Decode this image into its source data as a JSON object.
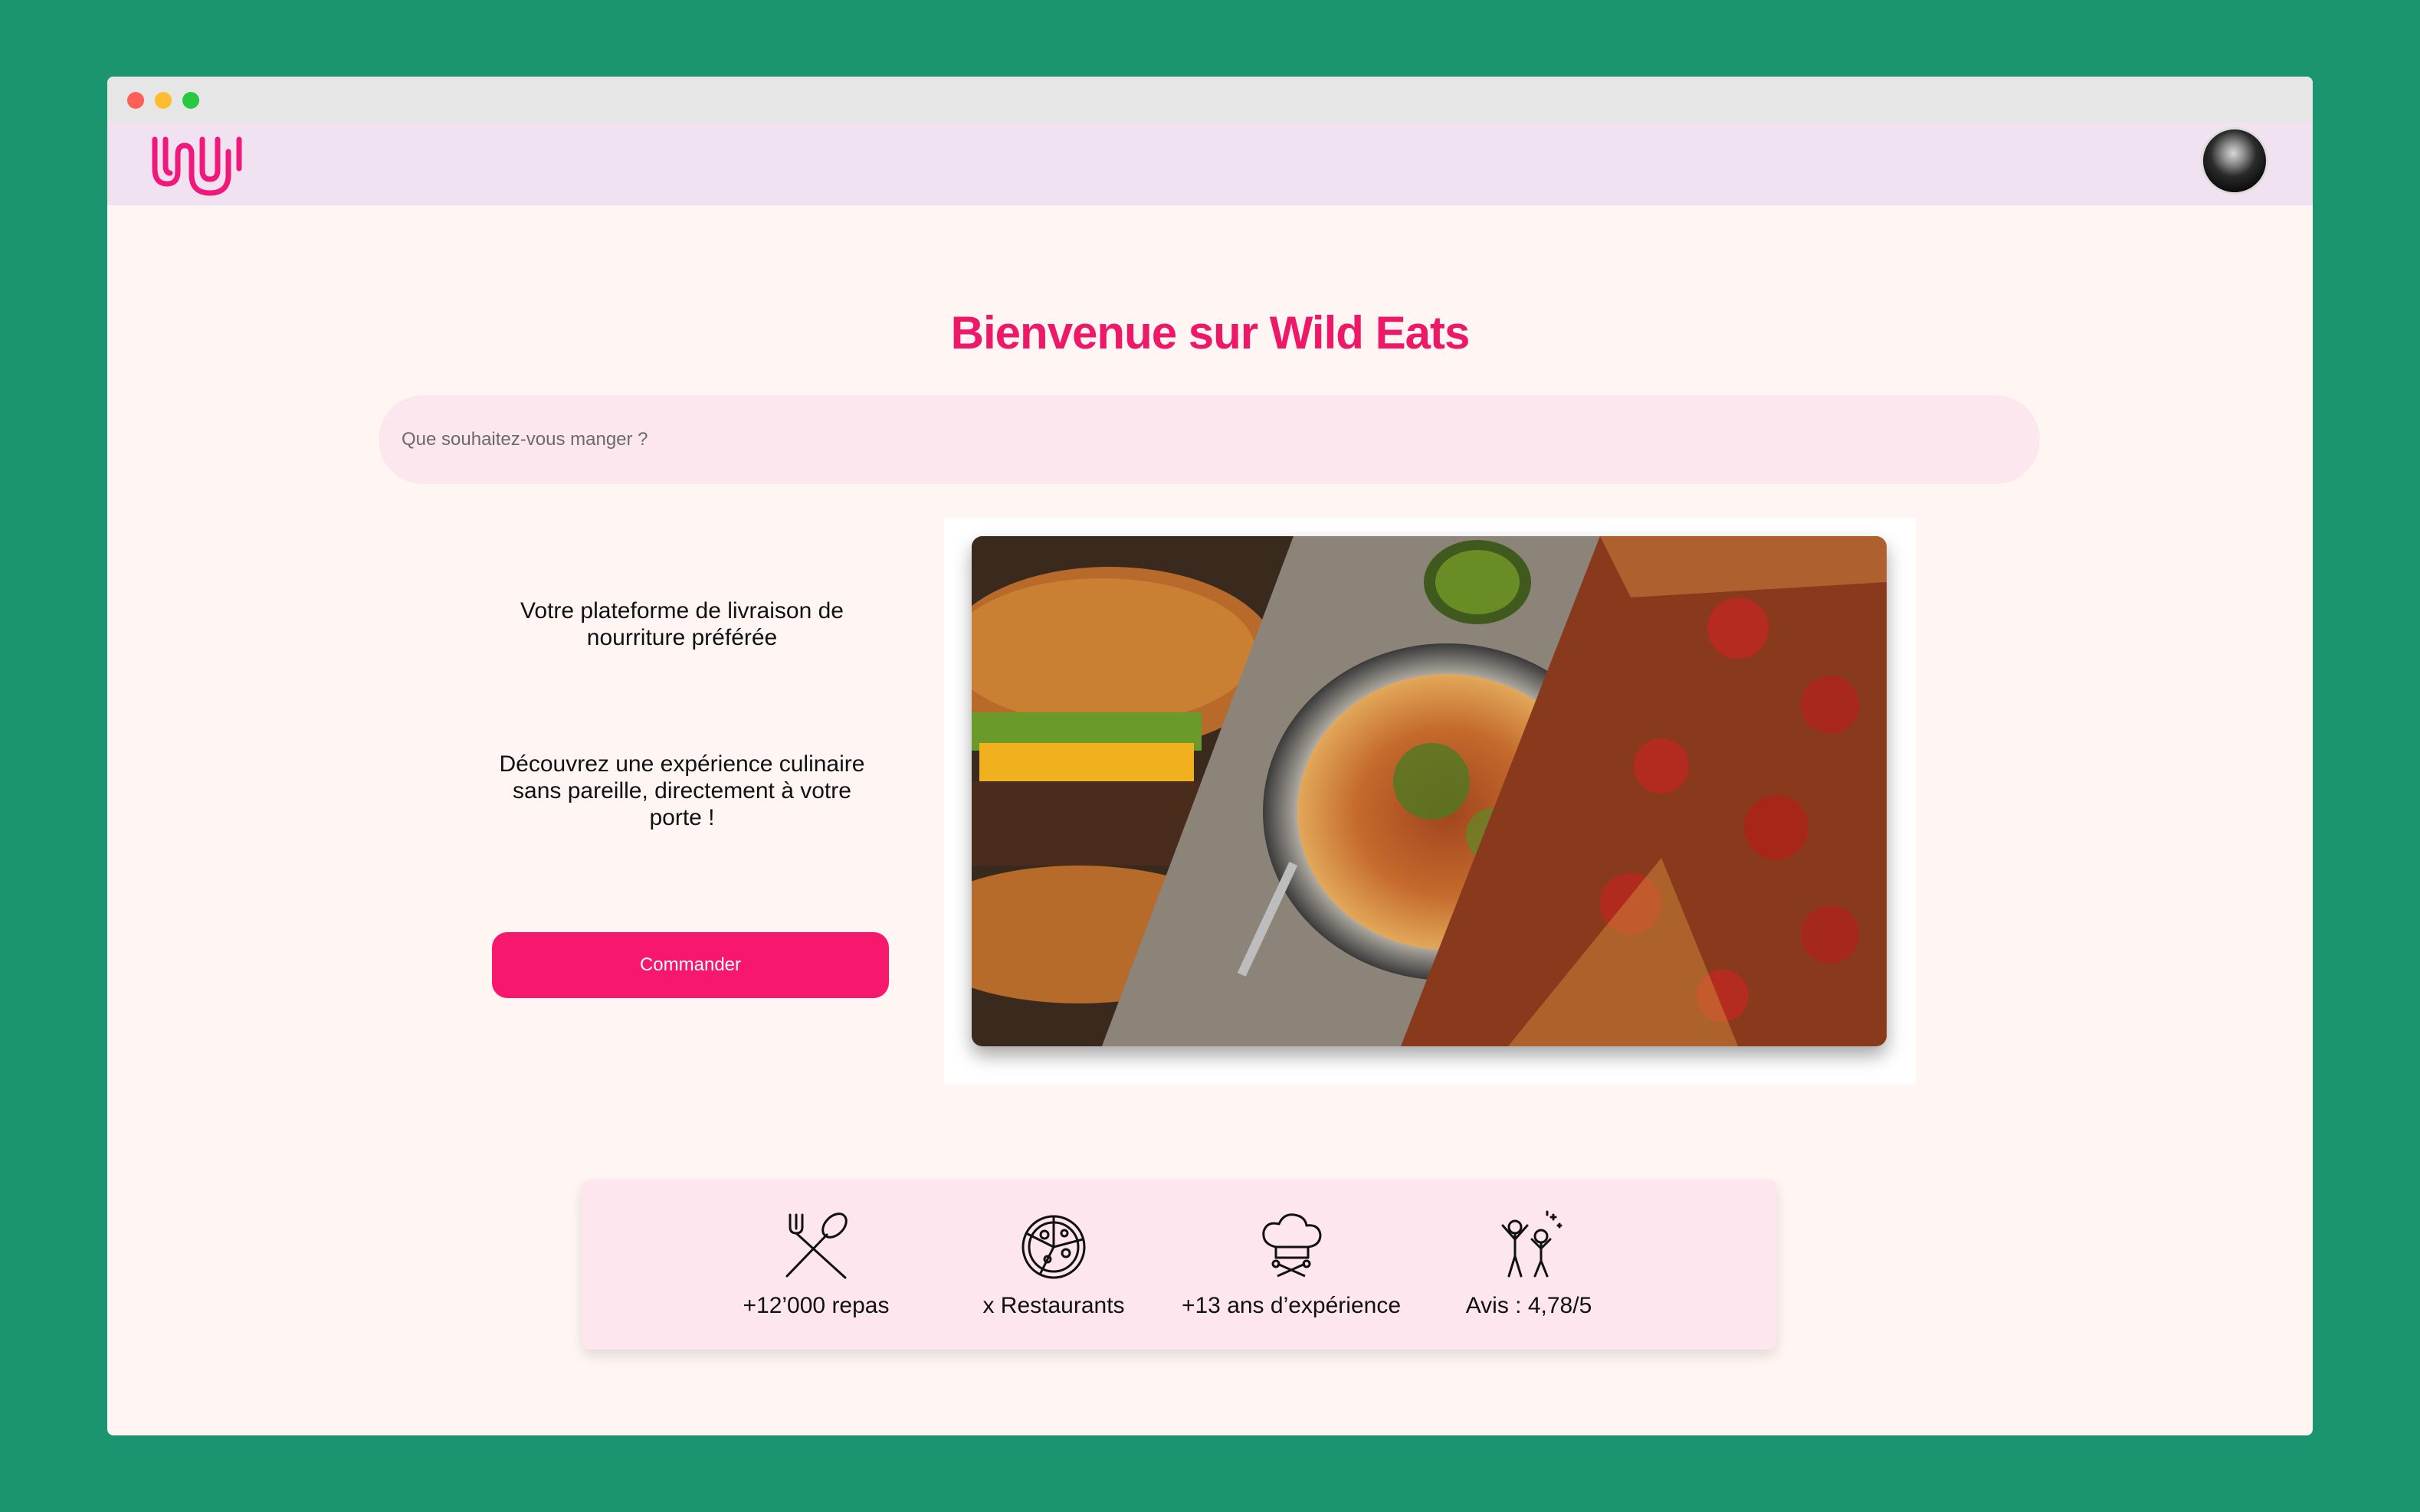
{
  "window": {
    "controls": [
      "close",
      "minimize",
      "maximize"
    ]
  },
  "navbar": {
    "logo_icon": "wild-eats-logo",
    "avatar_icon": "user-avatar"
  },
  "hero": {
    "title": "Bienvenue sur Wild Eats",
    "search_placeholder": "Que souhaitez-vous manger ?",
    "tagline": "Votre plateforme de livraison de nourriture préférée",
    "description": "Découvrez une expérience culinaire sans pareille, directement à votre porte !",
    "cta_label": "Commander"
  },
  "stats": [
    {
      "icon": "fork-spoon-icon",
      "label": "+12’000 repas"
    },
    {
      "icon": "pizza-icon",
      "label": "x Restaurants"
    },
    {
      "icon": "chef-hat-icon",
      "label": "+13 ans d’expérience"
    },
    {
      "icon": "happy-people-icon",
      "label": "Avis : 4,78/5"
    }
  ],
  "colors": {
    "background": "#1b9570",
    "accent": "#ee1868",
    "button": "#f7176c",
    "navbar": "#f1e2f1",
    "page": "#fff6f4",
    "search": "#fde7ef"
  }
}
